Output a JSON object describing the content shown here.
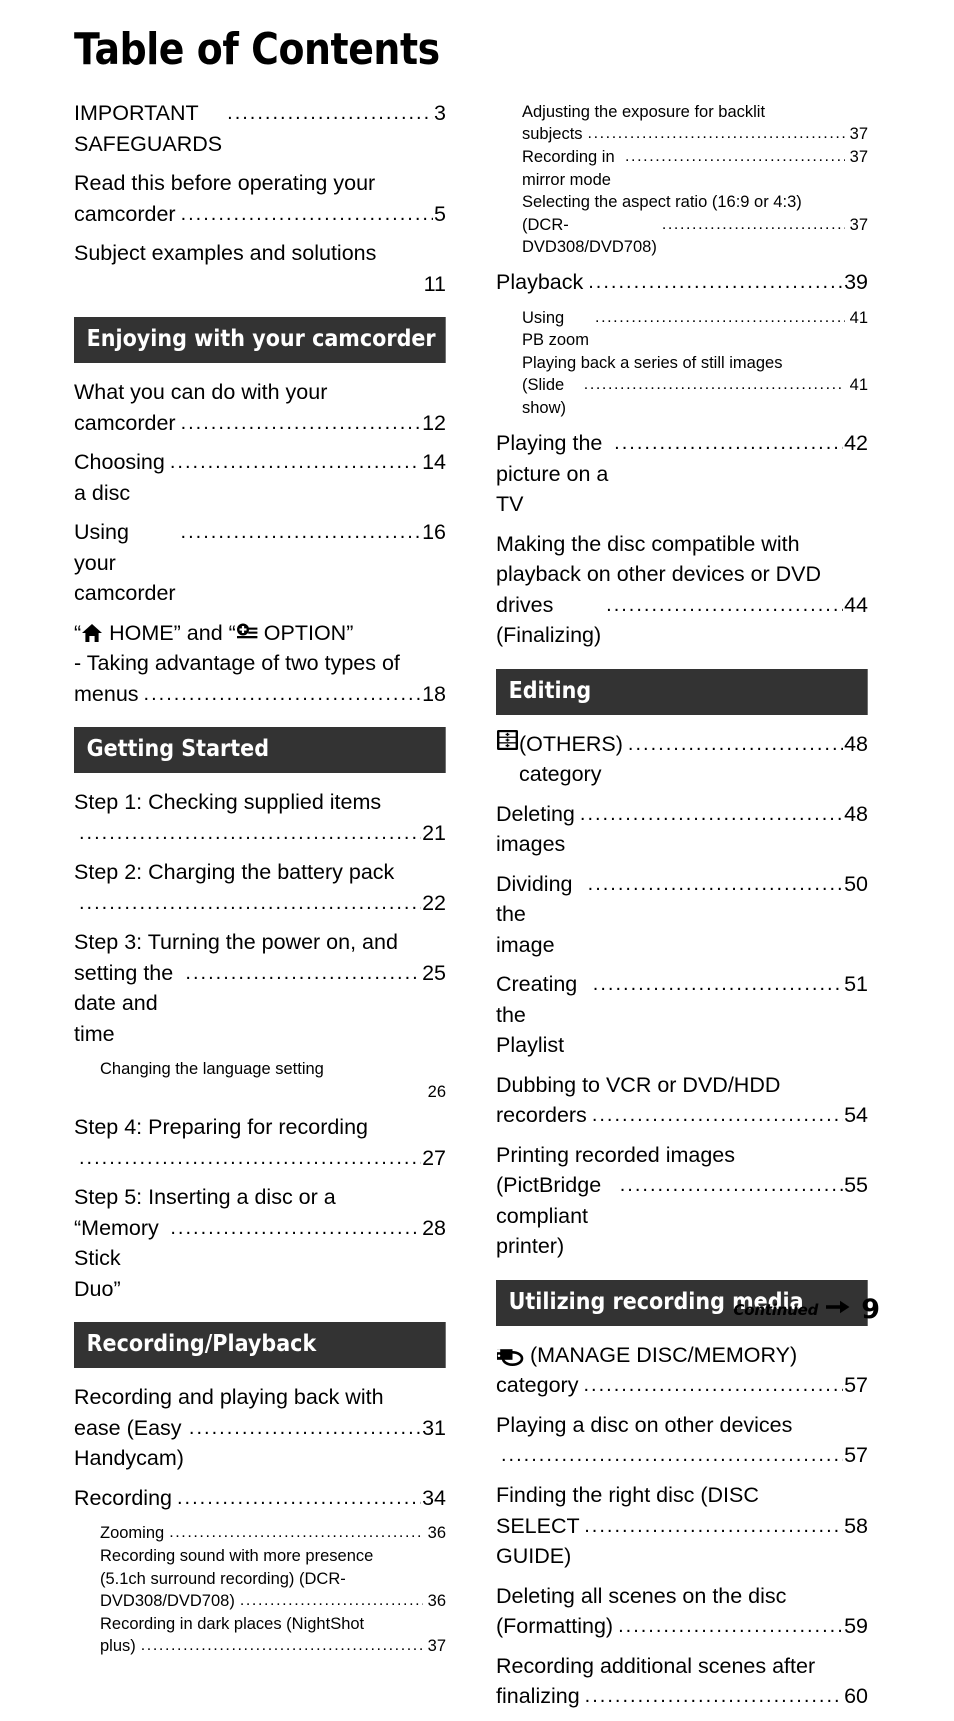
{
  "document": {
    "title": "Table of Contents",
    "page_number": "9",
    "continued_label": "Continued"
  },
  "colors": {
    "section_bar_background": "#333333",
    "section_bar_text": "#FFFFFF",
    "body_text": "#000000",
    "page_background": "#FFFFFF"
  },
  "left_column": {
    "intro_entries": [
      {
        "text": "IMPORTANT SAFEGUARDS",
        "page": "3",
        "leader": true
      },
      {
        "text": "Read this before operating your\ncamcorder",
        "page": "5",
        "leader": true
      },
      {
        "text": "Subject examples and solutions",
        "page": "11",
        "leader": false
      }
    ],
    "sections": [
      {
        "heading": "Enjoying with your camcorder",
        "entries": [
          {
            "text": "What you can do with your\ncamcorder",
            "page": "12",
            "leader": true
          },
          {
            "text": "Choosing a disc",
            "page": "14",
            "leader": true
          },
          {
            "text": "Using your camcorder",
            "page": "16",
            "leader": true
          },
          {
            "icon_line": true,
            "prefix": "“",
            "icon1": "home-icon",
            "middle": " HOME” and “",
            "icon2": "option-icon",
            "suffix": " OPTION”",
            "text": "- Taking advantage of two types of\nmenus",
            "page": "18",
            "leader": true
          }
        ]
      },
      {
        "heading": "Getting Started",
        "entries": [
          {
            "text": "Step 1: Checking supplied items",
            "page": "21",
            "leader": true,
            "leader_own_line": true
          },
          {
            "text": "Step 2: Charging the battery pack",
            "page": "22",
            "leader": true,
            "leader_own_line": true
          },
          {
            "text": "Step 3: Turning the power on, and\nsetting the date and time",
            "page": "25",
            "leader": true
          },
          {
            "text": "Changing the language setting",
            "page": "26",
            "leader": false,
            "sub": true
          },
          {
            "text": "Step 4: Preparing for recording",
            "page": "27",
            "leader": true,
            "leader_own_line": true
          },
          {
            "text": "Step 5: Inserting a disc or a\n“Memory Stick Duo”",
            "page": "28",
            "leader": true
          }
        ]
      },
      {
        "heading": "Recording/Playback",
        "entries": [
          {
            "text": "Recording and playing back with\nease (Easy Handycam)",
            "page": "31",
            "leader": true
          },
          {
            "text": "Recording",
            "page": "34",
            "leader": true
          },
          {
            "text": "Zooming",
            "page": "36",
            "leader": true,
            "sub": true
          },
          {
            "text": "Recording sound with more presence\n(5.1ch surround recording) (DCR-\nDVD308/DVD708)",
            "page": "36",
            "leader": true,
            "sub": true
          },
          {
            "text": "Recording in dark places (NightShot\nplus)",
            "page": "37",
            "leader": true,
            "sub": true
          }
        ]
      }
    ]
  },
  "right_column": {
    "intro_entries": [
      {
        "text": "Adjusting the exposure for backlit\nsubjects",
        "page": "37",
        "leader": true,
        "sub": true
      },
      {
        "text": "Recording in mirror mode",
        "page": "37",
        "leader": true,
        "sub": true
      },
      {
        "text": "Selecting the aspect ratio (16:9 or 4:3)\n(DCR-DVD308/DVD708)",
        "page": "37",
        "leader": true,
        "sub": true
      },
      {
        "text": "Playback",
        "page": "39",
        "leader": true
      },
      {
        "text": "Using PB zoom",
        "page": "41",
        "leader": true,
        "sub": true
      },
      {
        "text": "Playing back a series of still images\n(Slide show)",
        "page": "41",
        "leader": true,
        "sub": true
      },
      {
        "text": "Playing the picture on a TV",
        "page": "42",
        "leader": true
      },
      {
        "text": "Making the disc compatible with\nplayback on other devices or DVD\ndrives (Finalizing)",
        "page": "44",
        "leader": true
      }
    ],
    "sections": [
      {
        "heading": "Editing",
        "entries": [
          {
            "icon_prefix": true,
            "icon1": "others-category-icon",
            "text": "(OTHERS) category",
            "page": "48",
            "leader": true
          },
          {
            "text": "Deleting images",
            "page": "48",
            "leader": true
          },
          {
            "text": "Dividing the image",
            "page": "50",
            "leader": true
          },
          {
            "text": "Creating the Playlist",
            "page": "51",
            "leader": true
          },
          {
            "text": "Dubbing to VCR or DVD/HDD\nrecorders",
            "page": "54",
            "leader": true
          },
          {
            "text": "Printing recorded images\n(PictBridge compliant printer)",
            "page": "55",
            "leader": true
          }
        ]
      },
      {
        "heading": "Utilizing recording media",
        "entries": [
          {
            "icon_prefix": true,
            "icon1": "manage-disc-memory-icon",
            "text": " (MANAGE DISC/MEMORY)\ncategory",
            "page": "57",
            "leader": true
          },
          {
            "text": "Playing a disc on other devices",
            "page": "57",
            "leader": true,
            "leader_own_line": true
          },
          {
            "text": "Finding the right disc (DISC\nSELECT GUIDE)",
            "page": "58",
            "leader": true
          },
          {
            "text": "Deleting all scenes on the disc\n(Formatting)",
            "page": "59",
            "leader": true
          },
          {
            "text": "Recording additional scenes after\nfinalizing",
            "page": "60",
            "leader": true
          }
        ]
      }
    ]
  }
}
